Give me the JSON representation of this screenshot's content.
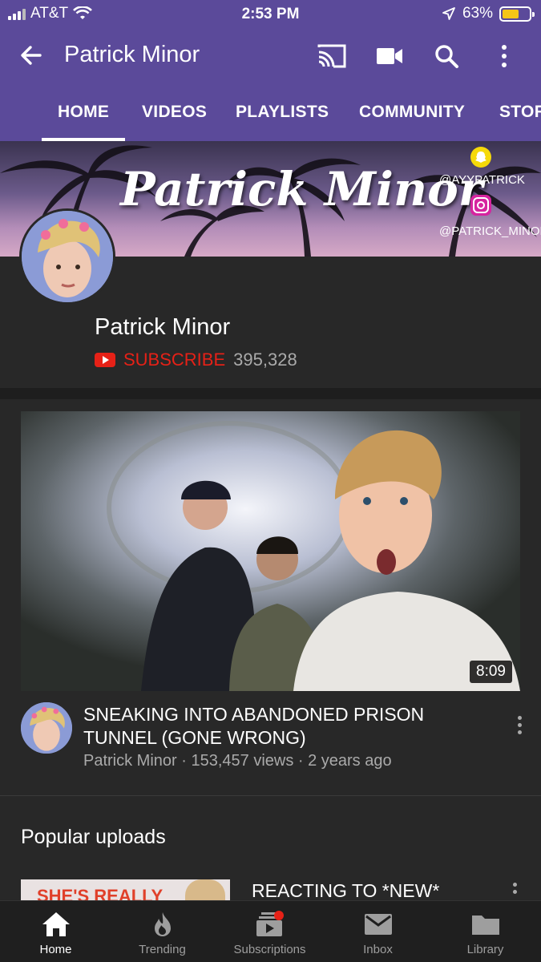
{
  "status_bar": {
    "carrier": "AT&T",
    "time": "2:53 PM",
    "battery_percent": "63%",
    "battery_level": 0.63,
    "battery_color": "#f5c518"
  },
  "app_bar": {
    "title": "Patrick Minor",
    "icons": [
      "back-arrow-icon",
      "cast-icon",
      "camera-icon",
      "search-icon",
      "more-vert-icon"
    ],
    "background": "#5b4a9a"
  },
  "tabs": [
    {
      "label": "HOME",
      "active": true
    },
    {
      "label": "VIDEOS",
      "active": false
    },
    {
      "label": "PLAYLISTS",
      "active": false
    },
    {
      "label": "COMMUNITY",
      "active": false
    },
    {
      "label": "STOR",
      "active": false
    }
  ],
  "banner": {
    "title": "Patrick Minor",
    "handle_snapchat": "@AYYPATRICK",
    "handle_instagram": "@PATRICK_MINOR"
  },
  "channel": {
    "name": "Patrick Minor",
    "subscribe_label": "SUBSCRIBE",
    "subscriber_count": "395,328",
    "accent_color": "#e62117"
  },
  "featured_video": {
    "title": "SNEAKING INTO ABANDONED PRISON TUNNEL (GONE WRONG)",
    "meta": "Patrick Minor · 153,457 views · 2 years ago",
    "duration": "8:09"
  },
  "popular_uploads": {
    "section_title": "Popular uploads",
    "items": [
      {
        "thumb_text": "SHE'S REALLY",
        "title": "REACTING TO *NEW*"
      }
    ]
  },
  "bottom_nav": [
    {
      "label": "Home",
      "icon": "home-icon",
      "active": true
    },
    {
      "label": "Trending",
      "icon": "trending-flame-icon",
      "active": false
    },
    {
      "label": "Subscriptions",
      "icon": "subscriptions-icon",
      "active": false
    },
    {
      "label": "Inbox",
      "icon": "inbox-mail-icon",
      "active": false
    },
    {
      "label": "Library",
      "icon": "library-folder-icon",
      "active": false
    }
  ]
}
